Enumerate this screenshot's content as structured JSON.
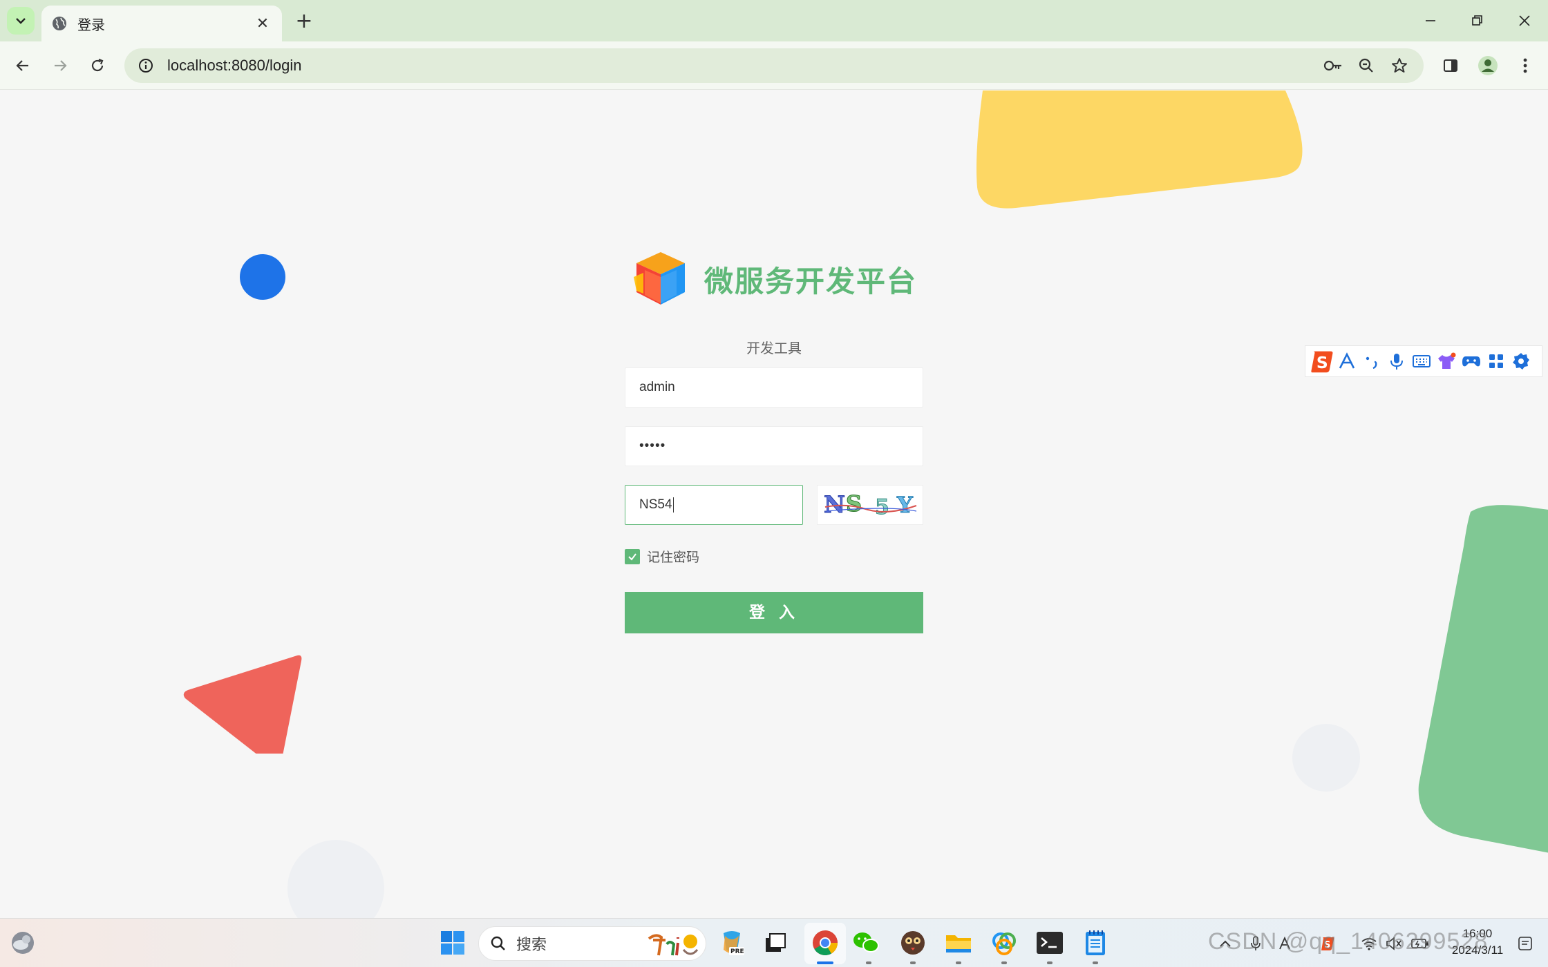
{
  "browser": {
    "tab_title": "登录",
    "tab_close": "✕",
    "new_tab": "+",
    "url": "localhost:8080/login"
  },
  "login": {
    "brand_title": "微服务开发平台",
    "subtitle": "开发工具",
    "username_value": "admin",
    "password_value": "•••••",
    "captcha_value": "NS54",
    "captcha_image_text": "NS5Y",
    "remember_label": "记住密码",
    "remember_checked": true,
    "login_button": "登 入"
  },
  "ime": {
    "items": [
      "sogou-logo",
      "A",
      "punct",
      "mic",
      "keyboard",
      "skin",
      "game",
      "apps",
      "settings"
    ]
  },
  "taskbar": {
    "search_label": "搜索",
    "clock_time": "16:00",
    "clock_date": "2024/3/11",
    "watermark": "CSDN @qq_1406299528"
  },
  "colors": {
    "accent": "#5fb878",
    "yellow_shape": "#fdd764",
    "blue_dot": "#1e73e8",
    "red_triangle": "#ef645b",
    "green_shape": "#80c894"
  }
}
